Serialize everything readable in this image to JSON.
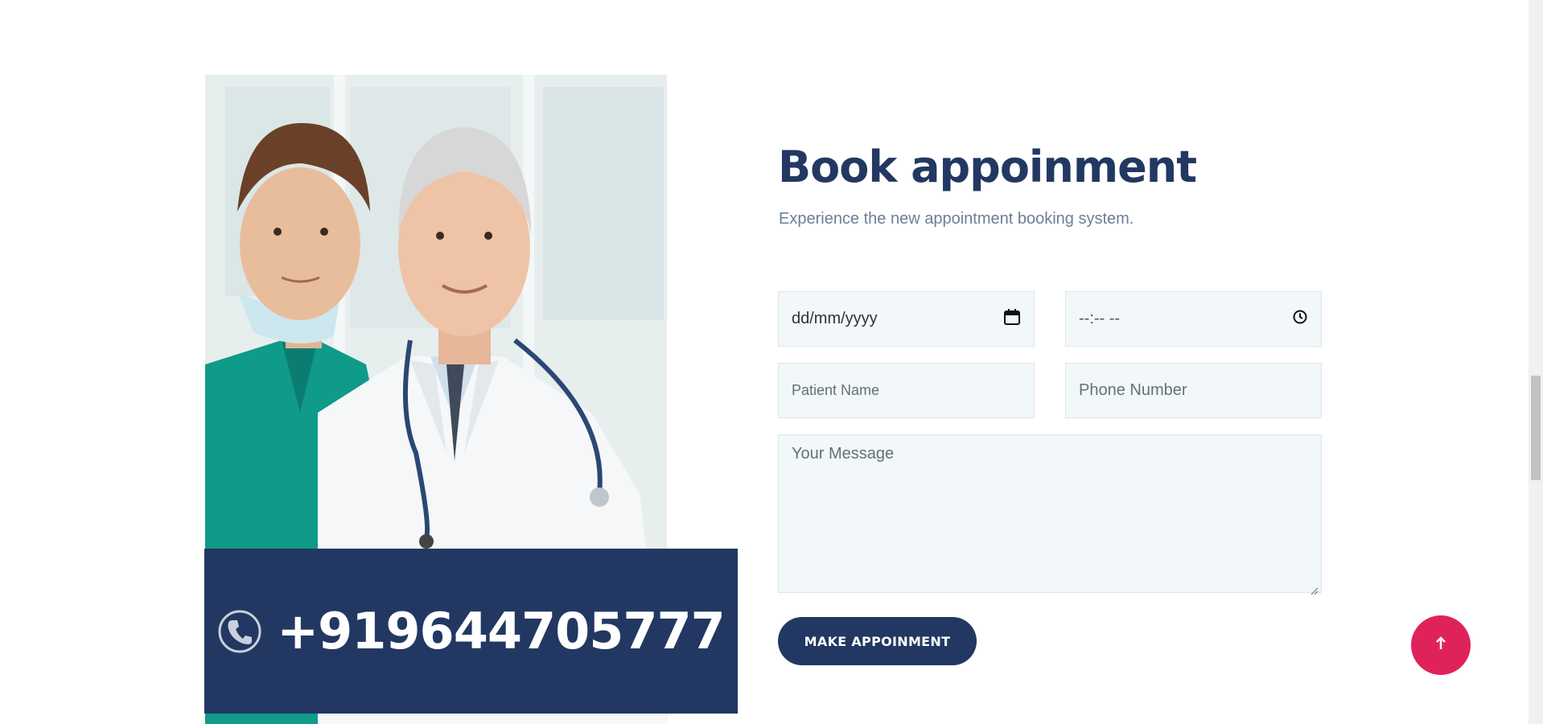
{
  "booking": {
    "title": "Book appoinment",
    "subtitle": "Experience the new appointment booking system.",
    "date_placeholder": "dd/mm/yyyy",
    "time_placeholder": "--:-- --",
    "name_placeholder": "Patient Name",
    "phone_placeholder": "Phone Number",
    "message_placeholder": "Your Message",
    "submit_label": "MAKE APPOINMENT"
  },
  "contact": {
    "phone": "+919644705777"
  },
  "icons": {
    "phone": "phone-icon",
    "calendar": "calendar-icon",
    "clock": "clock-icon",
    "scroll_top": "arrow-up-icon"
  },
  "colors": {
    "primary": "#223862",
    "accent": "#e0225a",
    "field_bg": "#f2f7f9"
  }
}
